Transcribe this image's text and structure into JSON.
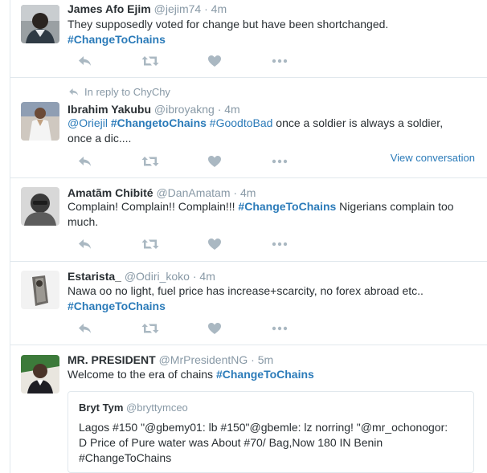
{
  "tweets": [
    {
      "fullname": "James Afo Ejim",
      "username": "@jejim74",
      "time": "· 4m",
      "text": "They supposedly voted for change but have been shortchanged.",
      "hashtag": "#ChangeToChains"
    },
    {
      "reply_context": "In reply to ChyChy",
      "fullname": "Ibrahim Yakubu",
      "username": "@ibroyakng",
      "time": "· 4m",
      "mention": "@Oriejil",
      "hashtag1": "#ChangetoChains",
      "hashtag2": "#GoodtoBad",
      "text_after": " once a soldier is always a soldier,",
      "text_line2": "once a dic....",
      "view_conversation": "View conversation"
    },
    {
      "fullname": "Amatãm Chibité",
      "username": "@DanAmatam",
      "time": "· 4m",
      "text_before": "Complain! Complain!! Complain!!! ",
      "hashtag": "#ChangeToChains",
      "text_after": " Nigerians complain too",
      "text_line2": "much."
    },
    {
      "fullname": "Estarista_",
      "username": "@Odiri_koko",
      "time": "· 4m",
      "text": "Nawa oo no light, fuel price has increase+scarcity, no forex abroad etc..",
      "hashtag": "#ChangeToChains"
    },
    {
      "fullname": "MR. PRESIDENT",
      "username": "@MrPresidentNG",
      "time": "· 5m",
      "text_before": "Welcome to the era of chains ",
      "hashtag": "#ChangeToChains",
      "quote": {
        "fullname": "Bryt Tym",
        "username": "@bryttymceo",
        "line1": "Lagos #150 \"@gbemy01: lb #150\"@gbemle: lz norring! \"@mr_ochonogor:",
        "line2": "D Price of Pure water was About #70/ Bag,Now 180 IN Benin",
        "line3": "#ChangeToChains"
      }
    }
  ],
  "colors": {
    "link": "#2b7bb9",
    "icon": "#aab8c2",
    "meta": "#8899a6",
    "text": "#292f33",
    "divider": "#e1e8ed"
  },
  "icons": [
    "reply-icon",
    "retweet-icon",
    "like-icon",
    "more-icon",
    "reply-context-icon"
  ]
}
